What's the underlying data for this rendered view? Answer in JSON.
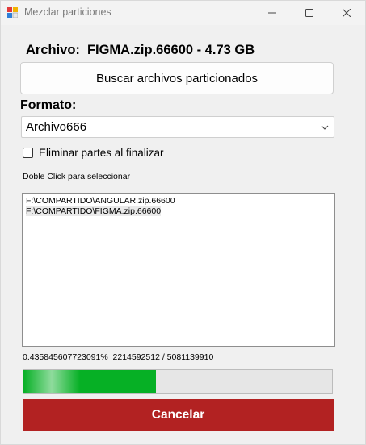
{
  "window": {
    "title": "Mezclar particiones"
  },
  "header": {
    "archivo_label": "Archivo:",
    "archivo_value": "FIGMA.zip.66600 - 4.73 GB"
  },
  "browse_button": {
    "label": "Buscar archivos particionados"
  },
  "formato": {
    "label": "Formato:",
    "selected": "Archivo666"
  },
  "delete_parts": {
    "label": "Eliminar partes al finalizar",
    "checked": false
  },
  "hint": "Doble Click para seleccionar",
  "files": [
    "F:\\COMPARTIDO\\ANGULAR.zip.66600",
    "F:\\COMPARTIDO\\FIGMA.zip.66600"
  ],
  "progress": {
    "text": "0.435845607723091%  2214592512 / 5081139910",
    "fraction": 0.43
  },
  "cancel_button": {
    "label": "Cancelar",
    "color": "#b22222"
  },
  "colors": {
    "progress_fill": "#06b025",
    "selection_bg": "#eaeaea"
  },
  "icons": {
    "app": "app-window-icon",
    "minimize": "minimize-icon",
    "maximize": "maximize-icon",
    "close": "close-icon",
    "dropdown": "chevron-down-icon"
  }
}
